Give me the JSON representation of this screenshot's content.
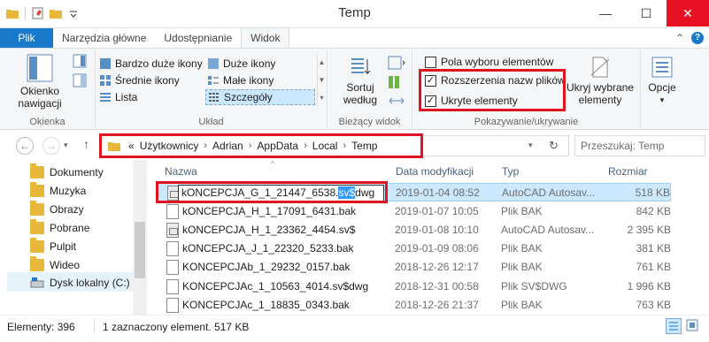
{
  "window": {
    "title": "Temp",
    "controls": {
      "minimize": "—",
      "maximize": "☐",
      "close": "✕"
    }
  },
  "ribbon_tabs": {
    "file": "Plik",
    "items": [
      "Narzędzia główne",
      "Udostępnianie",
      "Widok"
    ],
    "active": "Widok"
  },
  "ribbon": {
    "panes": {
      "nav_pane_label": "Okienko nawigacji",
      "group_label": "Okienka"
    },
    "layout": {
      "items": [
        "Bardzo duże ikony",
        "Duże ikony",
        "Średnie ikony",
        "Małe ikony",
        "Lista",
        "Szczegóły"
      ],
      "selected": "Szczegóły",
      "group_label": "Układ"
    },
    "current_view": {
      "sort_label": "Sortuj według",
      "group_label": "Bieżący widok"
    },
    "show_hide": {
      "item_checkboxes": {
        "label": "Pola wyboru elementów",
        "checked": false
      },
      "file_extensions": {
        "label": "Rozszerzenia nazw plików",
        "checked": true
      },
      "hidden_items": {
        "label": "Ukryte elementy",
        "checked": true
      },
      "hide_selected_label": "Ukryj wybrane elementy",
      "group_label": "Pokazywanie/ukrywanie"
    },
    "options_label": "Opcje"
  },
  "address": {
    "prefix": "«",
    "crumbs": [
      "Użytkownicy",
      "Adrian",
      "AppData",
      "Local",
      "Temp"
    ],
    "search_placeholder": "Przeszukaj: Temp"
  },
  "nav_pane": {
    "items": [
      "Dokumenty",
      "Muzyka",
      "Obrazy",
      "Pobrane",
      "Pulpit",
      "Wideo",
      "Dysk lokalny (C:)"
    ],
    "selected": "Dysk lokalny (C:)"
  },
  "file_list": {
    "columns": {
      "name": "Nazwa",
      "date": "Data modyfikacji",
      "type": "Typ",
      "size": "Rozmiar"
    },
    "rename": {
      "before": "kONCEPCJA_G_1_21447_6538.",
      "highlight": "sv$",
      "after": "dwg"
    },
    "rows": [
      {
        "name": "kONCEPCJA_G_1_21447_6538.sv$dwg",
        "date": "2019-01-04 08:52",
        "type": "AutoCAD Autosav...",
        "size": "518 KB",
        "icon": "dwg-file-icon"
      },
      {
        "name": "kONCEPCJA_H_1_17091_6431.bak",
        "date": "2019-01-07 10:05",
        "type": "Plik BAK",
        "size": "842 KB",
        "icon": "file-icon"
      },
      {
        "name": "kONCEPCJA_H_1_23362_4454.sv$",
        "date": "2019-01-08 10:10",
        "type": "AutoCAD Autosav...",
        "size": "2 395 KB",
        "icon": "dwg-file-icon"
      },
      {
        "name": "kONCEPCJA_J_1_22320_5233.bak",
        "date": "2019-01-09 08:06",
        "type": "Plik BAK",
        "size": "381 KB",
        "icon": "file-icon"
      },
      {
        "name": "KONCEPCJAb_1_29232_0157.bak",
        "date": "2018-12-26 12:17",
        "type": "Plik BAK",
        "size": "761 KB",
        "icon": "file-icon"
      },
      {
        "name": "KONCEPCJAc_1_10563_4014.sv$dwg",
        "date": "2018-12-31 00:58",
        "type": "Plik SV$DWG",
        "size": "1 996 KB",
        "icon": "file-icon"
      },
      {
        "name": "KONCEPCJAc_1_18835_0343.bak",
        "date": "2018-12-26 21:37",
        "type": "Plik BAK",
        "size": "763 KB",
        "icon": "file-icon"
      }
    ]
  },
  "status_bar": {
    "count": "Elementy: 396",
    "selection": "1 zaznaczony element. 517 KB"
  },
  "colors": {
    "file_tab": "#1979ca",
    "selection": "#cce8ff",
    "annotation": "#e0141e",
    "close_button": "#e81123"
  }
}
